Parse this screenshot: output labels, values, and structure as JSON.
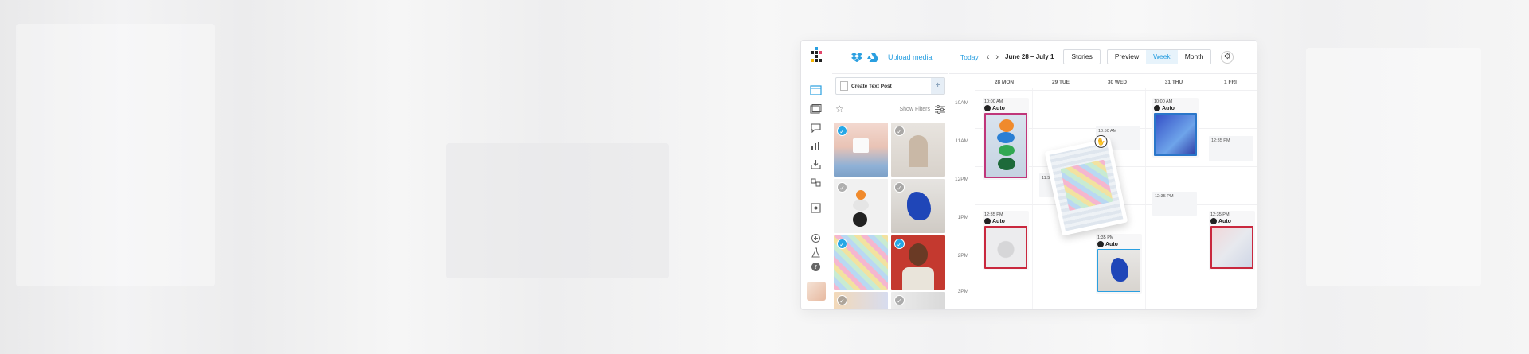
{
  "media_panel": {
    "upload_label": "Upload media",
    "create_text_post": "Create Text Post",
    "show_filters": "Show Filters"
  },
  "toolbar": {
    "today": "Today",
    "date_range": "June 28 – July 1",
    "stories": "Stories",
    "preview": "Preview",
    "week": "Week",
    "month": "Month"
  },
  "days": [
    "28 MON",
    "29 TUE",
    "30 WED",
    "31 THU",
    "1 FRI"
  ],
  "times": [
    "10AM",
    "11AM",
    "12PM",
    "1PM",
    "2PM",
    "3PM"
  ],
  "posts": {
    "mon_1": {
      "time": "10:00 AM",
      "label": "Auto"
    },
    "mon_2": {
      "time": "12:35 PM",
      "label": "Auto"
    },
    "wed_1": {
      "time": "1:35 PM",
      "label": "Auto"
    },
    "thu_1": {
      "time": "10:00 AM",
      "label": "Auto"
    },
    "fri_1": {
      "time": "12:35 PM",
      "label": "Auto"
    }
  },
  "slots": {
    "wed_a": "10:50 AM",
    "tue_a": "11:50 A",
    "thu_b": "12:35 PM",
    "fri_a": "12:35 PM"
  },
  "colors": {
    "accent": "#2a9fe0",
    "post_border_pink": "#c0367a",
    "post_border_red": "#c9283e",
    "post_border_blue": "#2a76c9"
  }
}
